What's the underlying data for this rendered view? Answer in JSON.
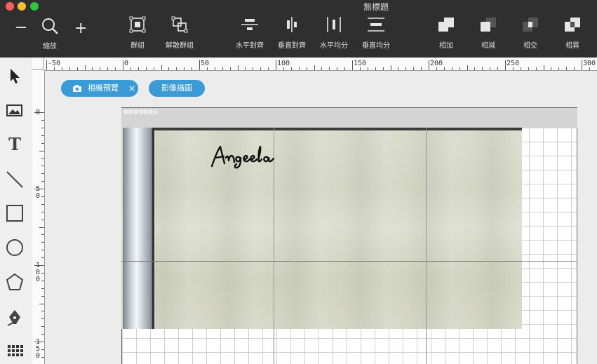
{
  "window": {
    "title": "無標題",
    "traffic_colors": [
      "#fe5f57",
      "#febc2e",
      "#28c840"
    ]
  },
  "toolbar": {
    "zoom": {
      "minus": "−",
      "plus": "+",
      "label": "縮放"
    },
    "group": "群組",
    "ungroup": "解散群組",
    "align_h": "水平對齊",
    "align_v": "垂直對齊",
    "distribute_h": "水平均分",
    "distribute_v": "垂直均分",
    "union": "相加",
    "subtract": "相減",
    "intersect": "相交",
    "exclude": "相異"
  },
  "tools": [
    "select-arrow-icon",
    "image-icon",
    "text-icon",
    "line-icon",
    "rectangle-icon",
    "ellipse-icon",
    "polygon-icon",
    "pen-icon",
    "grid-icon"
  ],
  "tool_text_glyph": "T",
  "chips": {
    "camera_preview": "相機預覽",
    "camera_close": "×",
    "image_trace": "影像描圖"
  },
  "ruler_top": {
    "labels": [
      "-50",
      "0",
      "50",
      "100",
      "150",
      "200",
      "250",
      "300"
    ]
  },
  "ruler_left": {
    "labels": [
      [
        "0"
      ],
      [
        "5",
        "0"
      ],
      [
        "1",
        "0",
        "0"
      ],
      [
        "1",
        "5",
        "0"
      ]
    ]
  },
  "canvas": {
    "photo_caption": "攝影機預覽畫面",
    "handwriting": "Angeela"
  },
  "colors": {
    "titlebar": "#2f2f2f",
    "chip": "#3b9bd6",
    "canvas_bg": "#ffffff"
  }
}
